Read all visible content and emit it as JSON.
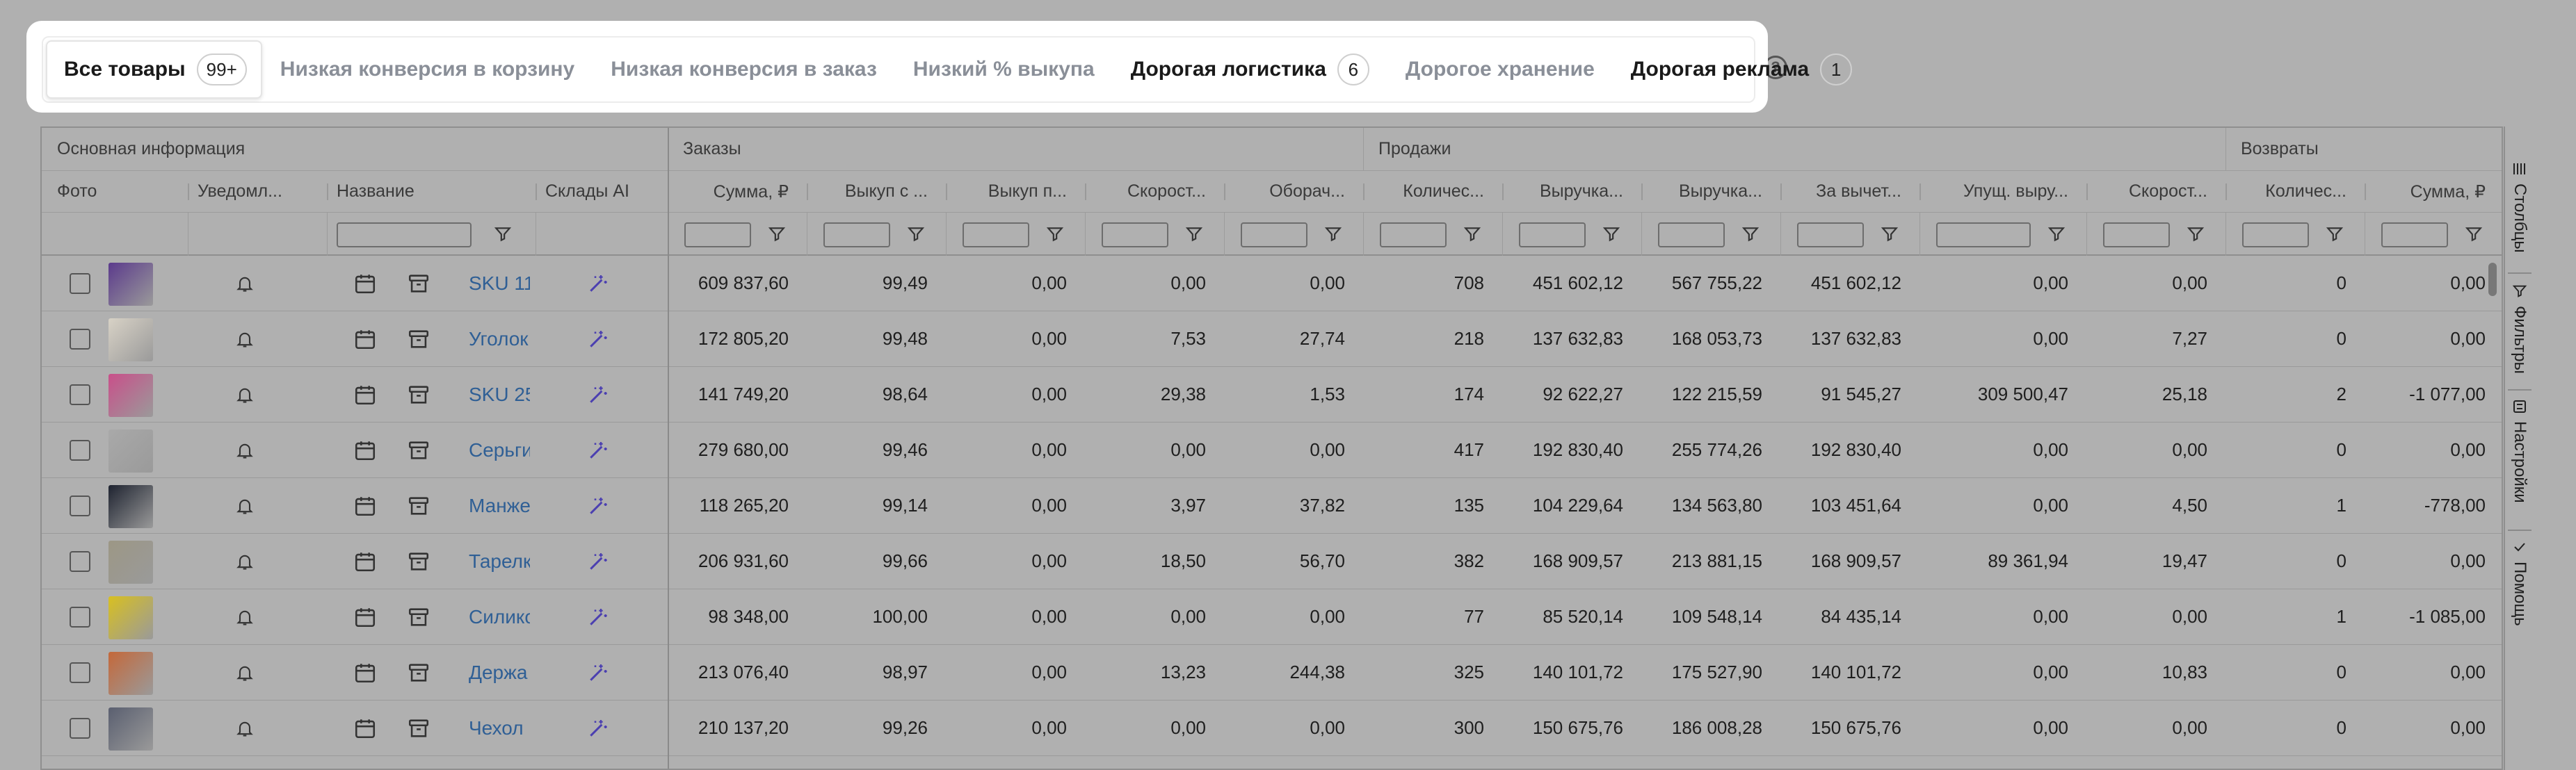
{
  "tabs": [
    {
      "label": "Все товары",
      "badge": "99+"
    },
    {
      "label": "Низкая конверсия в корзину"
    },
    {
      "label": "Низкая конверсия в заказ"
    },
    {
      "label": "Низкий % выкупа"
    },
    {
      "label": "Дорогая логистика",
      "badge": "6"
    },
    {
      "label": "Дорогое хранение"
    },
    {
      "label": "Дорогая реклама",
      "badge": "1"
    }
  ],
  "help_label": "?",
  "groups": {
    "main": "Основная информация",
    "orders": "Заказы",
    "sales": "Продажи",
    "returns": "Возвраты"
  },
  "columns": {
    "photo": "Фото",
    "notify": "Уведомл...",
    "name": "Название",
    "warehouses_ai": "Склады AI",
    "c1": "Сумма, ₽",
    "c2": "Выкуп с ...",
    "c3": "Выкуп п...",
    "c4": "Скорост...",
    "c5": "Оборач...",
    "c6": "Количес...",
    "c7": "Выручка...",
    "c8": "Выручка...",
    "c9": "За вычет...",
    "c10": "Упущ. выру...",
    "c11": "Скорост...",
    "c12": "Количес...",
    "c13": "Сумма, ₽"
  },
  "rows": [
    {
      "name": "SKU 11",
      "thumb_color": "#5b3a8c",
      "values": [
        "609 837,60",
        "99,49",
        "0,00",
        "0,00",
        "0,00",
        "708",
        "451 602,12",
        "567 755,22",
        "451 602,12",
        "0,00",
        "0,00",
        "0",
        "0,00"
      ]
    },
    {
      "name": "Уголок",
      "thumb_color": "#d8d2c6",
      "values": [
        "172 805,20",
        "99,48",
        "0,00",
        "7,53",
        "27,74",
        "218",
        "137 632,83",
        "168 053,73",
        "137 632,83",
        "0,00",
        "7,27",
        "0",
        "0,00"
      ]
    },
    {
      "name": "SKU 25",
      "thumb_color": "#c94f8a",
      "values": [
        "141 749,20",
        "98,64",
        "0,00",
        "29,38",
        "1,53",
        "174",
        "92 622,27",
        "122 215,59",
        "91 545,27",
        "309 500,47",
        "25,18",
        "2",
        "-1 077,00"
      ]
    },
    {
      "name": "Серьги",
      "thumb_color": "#a9a9a9",
      "values": [
        "279 680,00",
        "99,46",
        "0,00",
        "0,00",
        "0,00",
        "417",
        "192 830,40",
        "255 774,26",
        "192 830,40",
        "0,00",
        "0,00",
        "0",
        "0,00"
      ]
    },
    {
      "name": "Манже",
      "thumb_color": "#1e2330",
      "values": [
        "118 265,20",
        "99,14",
        "0,00",
        "3,97",
        "37,82",
        "135",
        "104 229,64",
        "134 563,80",
        "103 451,64",
        "0,00",
        "4,50",
        "1",
        "-778,00"
      ]
    },
    {
      "name": "Тарелк",
      "thumb_color": "#9c9785",
      "values": [
        "206 931,60",
        "99,66",
        "0,00",
        "18,50",
        "56,70",
        "382",
        "168 909,57",
        "213 881,15",
        "168 909,57",
        "89 361,94",
        "19,47",
        "0",
        "0,00"
      ]
    },
    {
      "name": "Силико",
      "thumb_color": "#d8c020",
      "values": [
        "98 348,00",
        "100,00",
        "0,00",
        "0,00",
        "0,00",
        "77",
        "85 520,14",
        "109 548,14",
        "84 435,14",
        "0,00",
        "0,00",
        "1",
        "-1 085,00"
      ]
    },
    {
      "name": "Держа",
      "thumb_color": "#c4683a",
      "values": [
        "213 076,40",
        "98,97",
        "0,00",
        "13,23",
        "244,38",
        "325",
        "140 101,72",
        "175 527,90",
        "140 101,72",
        "0,00",
        "10,83",
        "0",
        "0,00"
      ]
    },
    {
      "name": "Чехол",
      "thumb_color": "#5a5f70",
      "values": [
        "210 137,20",
        "99,26",
        "0,00",
        "0,00",
        "0,00",
        "300",
        "150 675,76",
        "186 008,28",
        "150 675,76",
        "0,00",
        "0,00",
        "0",
        "0,00"
      ]
    }
  ],
  "side_panel": [
    {
      "label": "Столбцы",
      "icon": "columns-icon"
    },
    {
      "label": "Фильтры",
      "icon": "filter-icon"
    },
    {
      "label": "Настройки",
      "icon": "settings-icon"
    },
    {
      "label": "Помощь",
      "icon": "check-icon"
    }
  ],
  "colors": {
    "overlay": "#b0b0b0",
    "link": "#2f5f95",
    "ai_icon": "#4b3fb0",
    "muted_tab": "#8a8f98"
  }
}
